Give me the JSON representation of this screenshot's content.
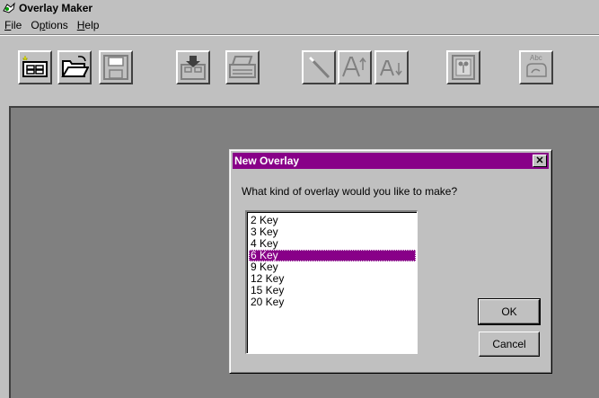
{
  "window": {
    "title": "Overlay Maker"
  },
  "menu": [
    {
      "label": "File",
      "accel_index": 0
    },
    {
      "label": "Options",
      "accel_index": 1
    },
    {
      "label": "Help",
      "accel_index": 0
    }
  ],
  "toolbar": {
    "buttons": [
      {
        "name": "new-overlay-button",
        "icon": "new-grid-icon"
      },
      {
        "name": "open-button",
        "icon": "folder-open-icon"
      },
      {
        "name": "save-button",
        "icon": "floppy-disk-icon"
      },
      {
        "name": "import-button",
        "icon": "download-tray-icon"
      },
      {
        "name": "print-button",
        "icon": "printer-icon"
      },
      {
        "name": "wand-button",
        "icon": "magic-wand-icon"
      },
      {
        "name": "font-larger-button",
        "icon": "text-larger-icon"
      },
      {
        "name": "font-smaller-button",
        "icon": "text-smaller-icon"
      },
      {
        "name": "picture-button",
        "icon": "picture-frame-icon"
      },
      {
        "name": "text-button",
        "icon": "abc-hand-icon"
      }
    ]
  },
  "dialog": {
    "title": "New Overlay",
    "close_label": "✕",
    "prompt": "What kind of overlay would you like to make?",
    "options": [
      "2 Key",
      "3 Key",
      "4 Key",
      "6 Key",
      "9 Key",
      "12 Key",
      "15 Key",
      "20 Key"
    ],
    "selected": "6 Key",
    "ok_label": "OK",
    "cancel_label": "Cancel"
  },
  "colors": {
    "accent": "#880088",
    "face": "#c0c0c0",
    "workspace": "#808080"
  }
}
